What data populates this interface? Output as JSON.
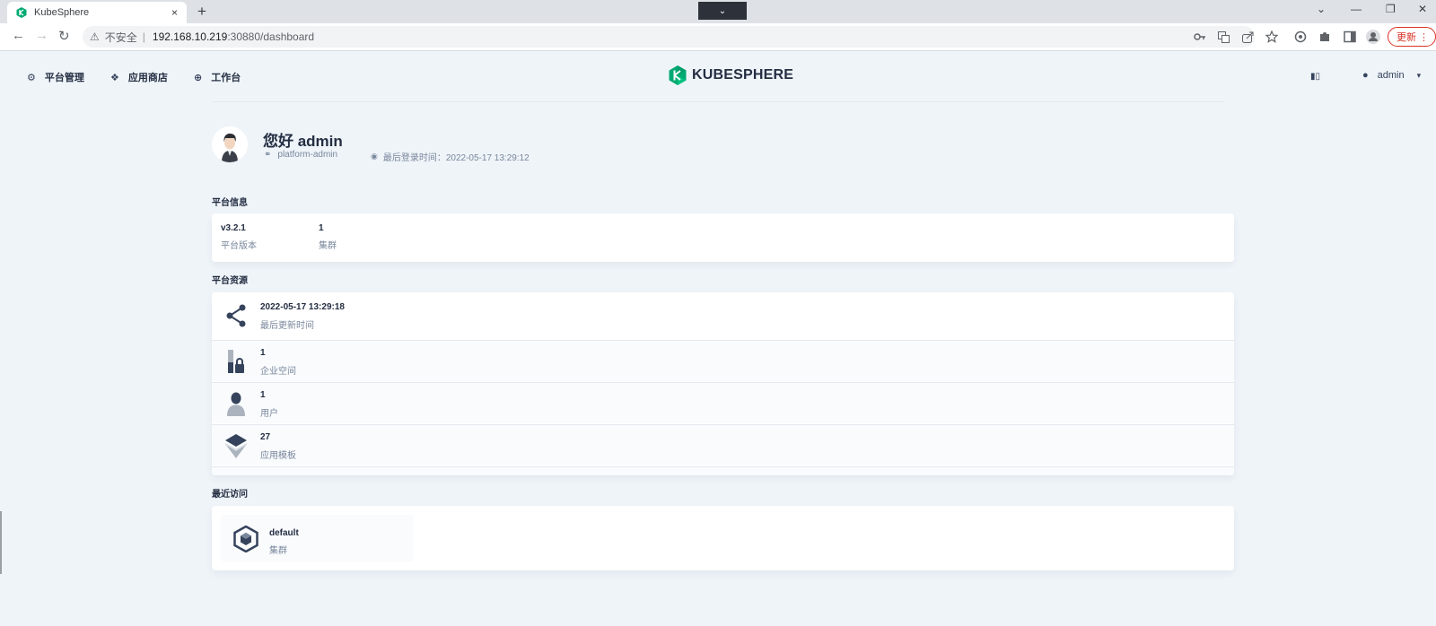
{
  "browser": {
    "tab_title": "KubeSphere",
    "tab_close": "×",
    "new_tab": "+",
    "tab_search": "⌄",
    "window_controls": [
      "⌄",
      "—",
      "❐",
      "✕"
    ],
    "nav": {
      "back": "←",
      "forward": "→",
      "reload": "↻"
    },
    "address": {
      "warn_icon": "⚠",
      "insecure_label": "不安全",
      "separator": "|",
      "host": "192.168.10.219",
      "rest": ":30880/dashboard"
    },
    "toolbar_icons": [
      "key-icon",
      "translate-icon",
      "share-icon",
      "star-icon",
      "extension-icon",
      "puzzle-icon",
      "sidepanel-icon",
      "profile-icon"
    ],
    "update_label": "更新 ⋮"
  },
  "header": {
    "nav_items": [
      {
        "icon": "gear-icon",
        "glyph": "⚙",
        "label": "平台管理"
      },
      {
        "icon": "app-store-icon",
        "glyph": "❖",
        "label": "应用商店"
      },
      {
        "icon": "workbench-icon",
        "glyph": "⊕",
        "label": "工作台"
      }
    ],
    "logo_text": "KUBESPHERE",
    "book_glyph": "▮▯",
    "user": {
      "glyph": "●",
      "name": "admin",
      "chevron": "▾"
    }
  },
  "welcome": {
    "greeting": "您好 admin",
    "role_glyph": "⚭",
    "role": "platform-admin",
    "lastlogin_glyph": "◉",
    "last_login": "最后登录时间：2022-05-17 13:29:12"
  },
  "platform_info": {
    "title": "平台信息",
    "items": [
      {
        "value": "v3.2.1",
        "label": "平台版本"
      },
      {
        "value": "1",
        "label": "集群"
      }
    ]
  },
  "platform_resources": {
    "title": "平台资源",
    "rows": [
      {
        "icon": "share-nodes-icon",
        "value": "2022-05-17 13:29:18",
        "label": "最后更新时间"
      },
      {
        "icon": "workspace-icon",
        "value": "1",
        "label": "企业空间"
      },
      {
        "icon": "user-icon",
        "value": "1",
        "label": "用户"
      },
      {
        "icon": "app-template-icon",
        "value": "27",
        "label": "应用模板"
      }
    ]
  },
  "recent": {
    "title": "最近访问",
    "items": [
      {
        "icon": "cluster-icon",
        "name": "default",
        "type": "集群"
      }
    ]
  },
  "colors": {
    "background": "#eff4f9",
    "text": "#242e42",
    "muted": "#79879c",
    "brand": "#00aa72",
    "update_red": "#d93025"
  }
}
